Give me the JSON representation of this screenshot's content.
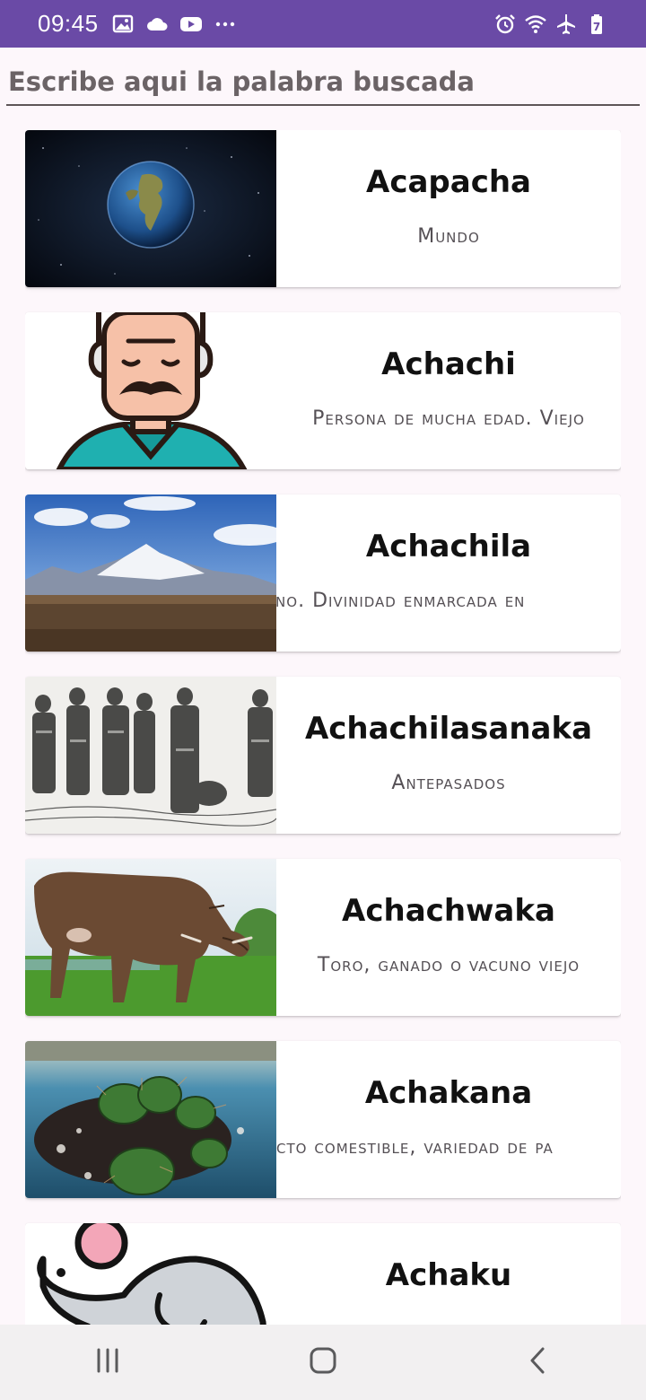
{
  "status_bar": {
    "time": "09:45",
    "left_icons": [
      "image-icon",
      "cloud-icon",
      "youtube-icon",
      "more-dots-icon"
    ],
    "right_icons": [
      "alarm-icon",
      "wifi-icon",
      "airplane-icon",
      "battery-icon"
    ],
    "battery_level": "7",
    "color": "#6a4aa6"
  },
  "search": {
    "placeholder": "Escribe aqui la palabra buscada",
    "value": ""
  },
  "entries": [
    {
      "word": "Acapacha",
      "meaning": "Mundo",
      "image": "earth-image"
    },
    {
      "word": "Achachi",
      "meaning": "Persona de mucha edad. Viejo",
      "image": "old-man-image"
    },
    {
      "word": "Achachila",
      "meaning": "Abuelo, anciano. Divinidad enmarcada en ",
      "image": "mountain-image"
    },
    {
      "word": "Achachilasanaka",
      "meaning": "Antepasados",
      "image": "ancestors-engraving-image"
    },
    {
      "word": "Achachwaka",
      "meaning": "Toro, ganado o vacuno viejo",
      "image": "cow-image"
    },
    {
      "word": "Achakana",
      "meaning": "cto comestible, variedad de pa",
      "image": "cactus-image"
    },
    {
      "word": "Achaku",
      "meaning": "",
      "image": "mouse-image"
    }
  ],
  "nav": {
    "recents": "recents-icon",
    "home": "home-icon",
    "back": "back-icon"
  }
}
